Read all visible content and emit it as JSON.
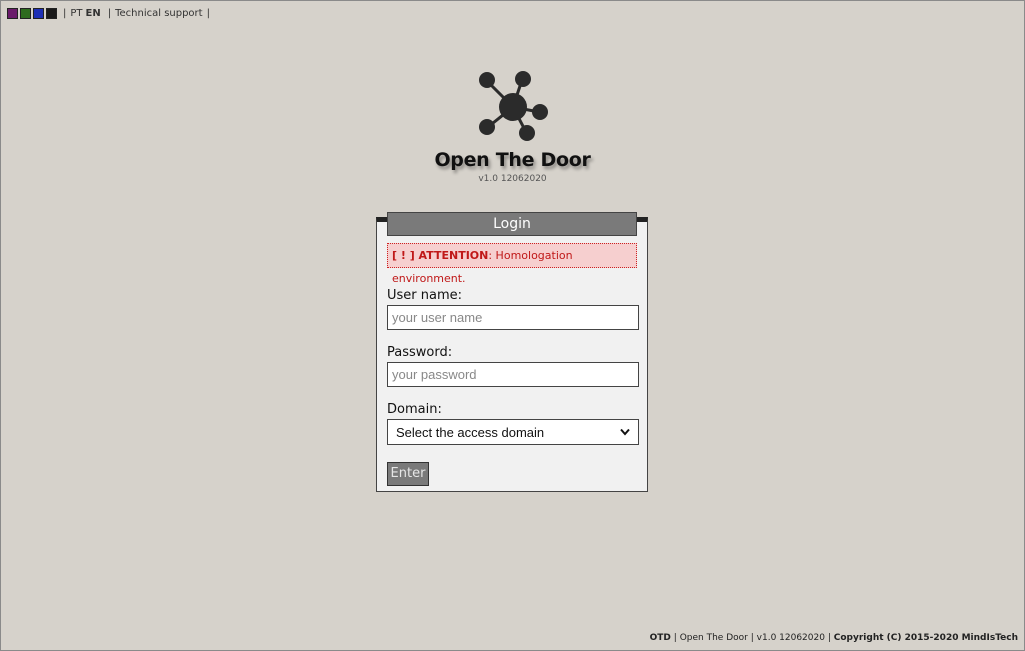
{
  "topbar": {
    "swatches": [
      "#6a1b6a",
      "#2e6b1e",
      "#1d2fb5",
      "#1a1a1a"
    ],
    "sep": "|",
    "lang_pt": "PT",
    "lang_en": "EN",
    "support": "Technical support"
  },
  "app": {
    "title": "Open The Door",
    "version": "v1.0 12062020"
  },
  "login": {
    "header": "Login",
    "alert_prefix": "[ ! ] ATTENTION",
    "alert_text": ": Homologation environment.",
    "username_label": "User name:",
    "username_placeholder": "your user name",
    "password_label": "Password:",
    "password_placeholder": "your password",
    "domain_label": "Domain:",
    "domain_selected": "Select the access domain",
    "enter_label": "Enter"
  },
  "footer": {
    "acronym": "OTD",
    "app_name": "Open The Door",
    "version": "v1.0 12062020",
    "copyright": "Copyright (C) 2015-2020 MindIsTech",
    "sep": "|"
  }
}
